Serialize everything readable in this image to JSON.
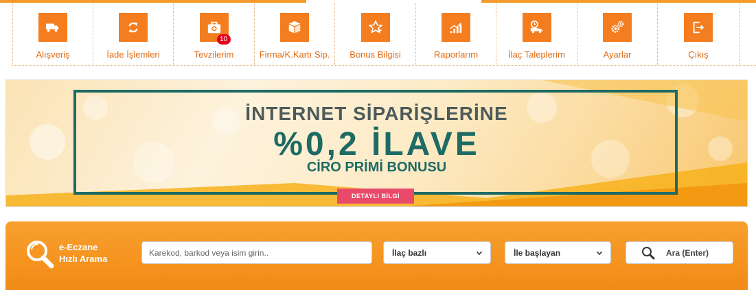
{
  "nav": {
    "items": [
      {
        "label": "Alışveriş",
        "icon": "truck-icon"
      },
      {
        "label": "İade İşlemleri",
        "icon": "refresh-icon"
      },
      {
        "label": "Tevzilerim",
        "icon": "medical-kit-icon",
        "badge": "10"
      },
      {
        "label": "Firma/K.Kartı Sip.",
        "icon": "box-icon"
      },
      {
        "label": "Bonus Bilgisi",
        "icon": "star-plus-icon"
      },
      {
        "label": "Raporlarım",
        "icon": "bar-chart-icon"
      },
      {
        "label": "İlaç Taleplerim",
        "icon": "delivery-clock-icon"
      },
      {
        "label": "Ayarlar",
        "icon": "gears-icon"
      },
      {
        "label": "Çıkış",
        "icon": "logout-icon"
      }
    ]
  },
  "banner": {
    "line1": "İNTERNET SİPARİŞLERİNE",
    "line2": "%0,2 İLAVE",
    "line3": "CİRO PRİMİ BONUSU",
    "button": "DETAYLI BİLGİ"
  },
  "search": {
    "title_line1": "e-Eczane",
    "title_line2": "Hızlı Arama",
    "input_placeholder": "Karekod, barkod veya isim girin..",
    "select_mode": "İlaç bazlı",
    "select_match": "İle başlayan",
    "button": "Ara (Enter)"
  },
  "colors": {
    "accent": "#f47d1f",
    "link": "#e06a14",
    "banner_teal": "#1d6b64",
    "badge": "#e3001b",
    "banner_button": "#e94a6a"
  }
}
